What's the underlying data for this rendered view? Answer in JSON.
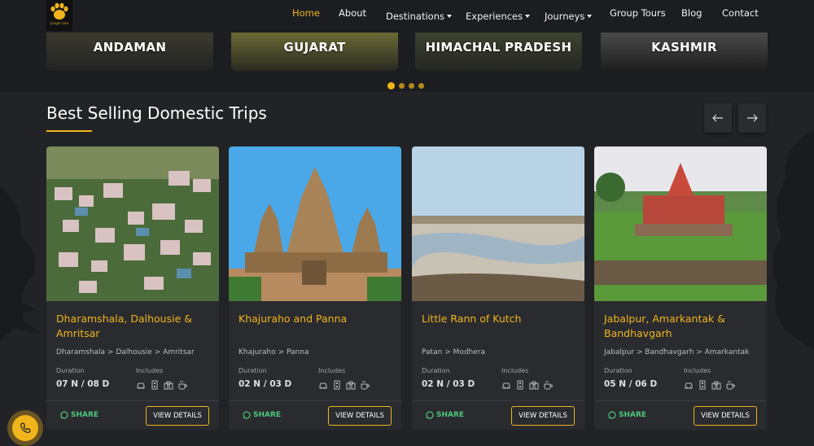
{
  "brand": {
    "logo_text": "Jungle Lore"
  },
  "nav": {
    "items": [
      {
        "label": "Home",
        "active": true
      },
      {
        "label": "About"
      },
      {
        "label": "Destinations",
        "dropdown": true
      },
      {
        "label": "Experiences",
        "dropdown": true
      },
      {
        "label": "Journeys",
        "dropdown": true
      },
      {
        "label": "Group Tours"
      },
      {
        "label": "Blog"
      },
      {
        "label": "Contact"
      }
    ]
  },
  "destinations": [
    {
      "label": "ANDAMAN"
    },
    {
      "label": "GUJARAT"
    },
    {
      "label": "HIMACHAL PRADESH"
    },
    {
      "label": "KASHMIR"
    }
  ],
  "carousel": {
    "dot_count": 4,
    "active_index": 0
  },
  "section": {
    "title": "Best Selling Domestic Trips",
    "prev_icon": "arrow-left-icon",
    "next_icon": "arrow-right-icon"
  },
  "labels": {
    "duration": "Duration",
    "includes": "Includes",
    "share": "SHARE",
    "view_details": "VIEW DETAILS"
  },
  "trips": [
    {
      "title": "Dharamshala, Dalhousie & Amritsar",
      "route": "Dharamshala > Dalhousie > Amritsar",
      "duration": "07 N / 08 D"
    },
    {
      "title": "Khajuraho and Panna",
      "route": "Khajuraho > Panna",
      "duration": "02 N / 03 D"
    },
    {
      "title": "Little Rann of Kutch",
      "route": "Patan > Modhera",
      "duration": "02 N / 03 D"
    },
    {
      "title": "Jabalpur, Amarkantak & Bandhavgarh",
      "route": "Jabalpur > Bandhavgarh > Amarkantak",
      "duration": "05 N / 06 D"
    }
  ],
  "includes_icons": [
    "car-icon",
    "hotel-icon",
    "binoculars-icon",
    "meal-icon"
  ],
  "colors": {
    "accent": "#f1b51c",
    "share_green": "#4fc77b",
    "background": "#222326"
  }
}
